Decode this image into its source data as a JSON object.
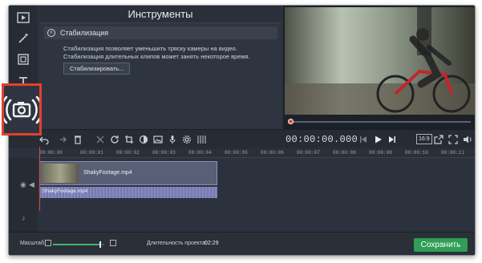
{
  "tools_panel": {
    "title": "Инструменты",
    "section_title": "Стабилизация",
    "description": "Стабилизация позволяет уменьшить тряску камеры на видео. Стабилизация длительных клипов может занять некоторое время.",
    "stabilize_button": "Стабилизировать..."
  },
  "player": {
    "timecode": "00:00:00.000",
    "aspect_ratio": "16:9"
  },
  "ruler": {
    "ticks": [
      "00:00:00",
      "00:00:01",
      "00:00:02",
      "00:00:03",
      "00:00:04",
      "00:00:05",
      "00:00:06",
      "00:00:07",
      "00:00:08",
      "00:00:09",
      "00:00:10",
      "00:00:11"
    ]
  },
  "timeline": {
    "video_clip_name": "ShakyFootage.mp4",
    "audio_clip_name": "ShakyFootage.mp4"
  },
  "bottom": {
    "scale_label": "Масштаб:",
    "duration_label": "Длительность проекта:",
    "duration_value": "02:29",
    "save_button": "Сохранить",
    "zoom_level": 0.92
  },
  "colors": {
    "accent_save": "#2f9e57",
    "highlight": "#e2412b",
    "playhead": "#e04a3a"
  }
}
